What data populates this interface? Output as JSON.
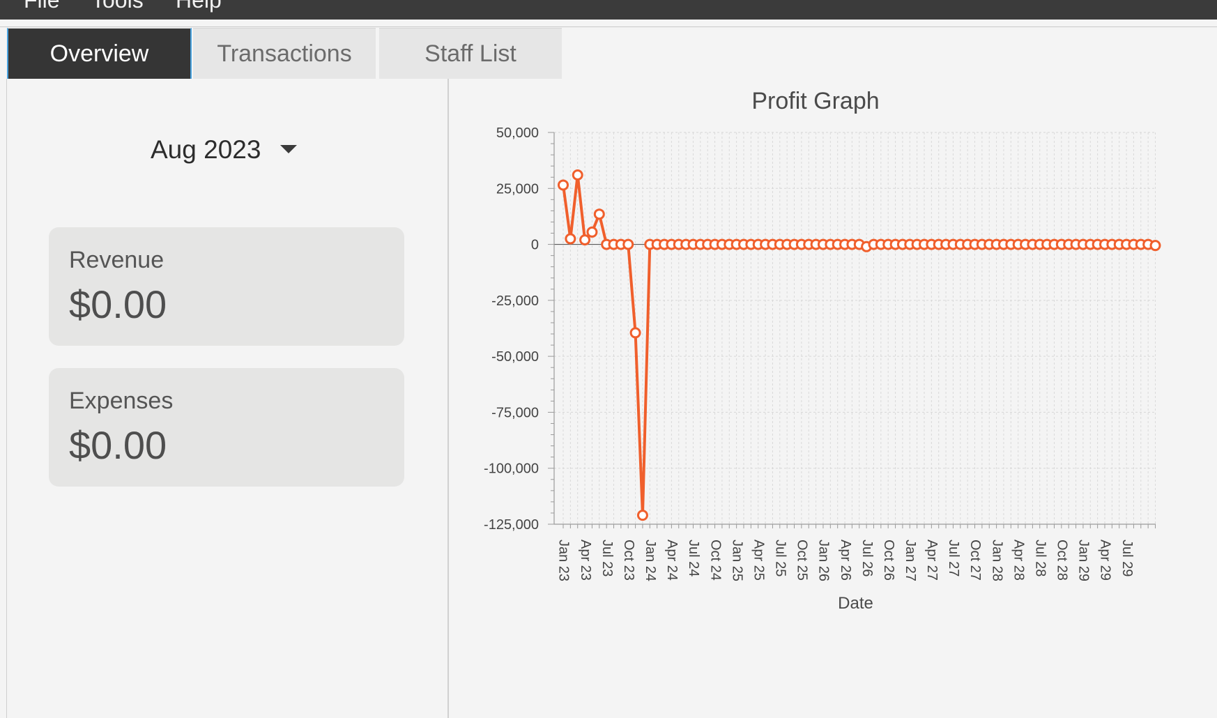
{
  "menu": {
    "items": [
      "File",
      "Tools",
      "Help"
    ]
  },
  "tabs": [
    {
      "label": "Overview",
      "active": true
    },
    {
      "label": "Transactions",
      "active": false
    },
    {
      "label": "Staff List",
      "active": false
    }
  ],
  "overview": {
    "month_selector": {
      "value": "Aug 2023",
      "icon": "chevron-down-icon"
    },
    "cards": [
      {
        "label": "Revenue",
        "value": "$0.00"
      },
      {
        "label": "Expenses",
        "value": "$0.00"
      }
    ]
  },
  "colors": {
    "accent": "#f05f2c",
    "dark": "#353535",
    "card": "#e5e5e4",
    "tab_border": "#4aa3df"
  },
  "chart_data": {
    "type": "line",
    "title": "Profit Graph",
    "xlabel": "Date",
    "ylabel": "",
    "ylim": [
      -125000,
      50000
    ],
    "y_ticks": [
      "50,000",
      "25,000",
      "0",
      "-25,000",
      "-50,000",
      "-75,000",
      "-100,000",
      "-125,000"
    ],
    "y_tick_values": [
      50000,
      25000,
      0,
      -25000,
      -50000,
      -75000,
      -100000,
      -125000
    ],
    "grid": true,
    "x_tick_labels": [
      "Jan 23",
      "Apr 23",
      "Jul 23",
      "Oct 23",
      "Jan 24",
      "Apr 24",
      "Jul 24",
      "Oct 24",
      "Jan 25",
      "Apr 25",
      "Jul 25",
      "Oct 25",
      "Jan 26",
      "Apr 26",
      "Jul 26",
      "Oct 26",
      "Jan 27",
      "Apr 27",
      "Jul 27",
      "Oct 27",
      "Jan 28",
      "Apr 28",
      "Jul 28",
      "Oct 28",
      "Jan 29",
      "Apr 29",
      "Jul 29"
    ],
    "x_categories": [
      "Jan 23",
      "Feb 23",
      "Mar 23",
      "Apr 23",
      "May 23",
      "Jun 23",
      "Jul 23",
      "Aug 23",
      "Sep 23",
      "Oct 23",
      "Nov 23",
      "Dec 23",
      "Jan 24",
      "Feb 24",
      "Mar 24",
      "Apr 24",
      "May 24",
      "Jun 24",
      "Jul 24",
      "Aug 24",
      "Sep 24",
      "Oct 24",
      "Nov 24",
      "Dec 24",
      "Jan 25",
      "Feb 25",
      "Mar 25",
      "Apr 25",
      "May 25",
      "Jun 25",
      "Jul 25",
      "Aug 25",
      "Sep 25",
      "Oct 25",
      "Nov 25",
      "Dec 25",
      "Jan 26",
      "Feb 26",
      "Mar 26",
      "Apr 26",
      "May 26",
      "Jun 26",
      "Jul 26",
      "Aug 26",
      "Sep 26",
      "Oct 26",
      "Nov 26",
      "Dec 26",
      "Jan 27",
      "Feb 27",
      "Mar 27",
      "Apr 27",
      "May 27",
      "Jun 27",
      "Jul 27",
      "Aug 27",
      "Sep 27",
      "Oct 27",
      "Nov 27",
      "Dec 27",
      "Jan 28",
      "Feb 28",
      "Mar 28",
      "Apr 28",
      "May 28",
      "Jun 28",
      "Jul 28",
      "Aug 28",
      "Sep 28",
      "Oct 28",
      "Nov 28",
      "Dec 28",
      "Jan 29",
      "Feb 29",
      "Mar 29",
      "Apr 29",
      "May 29",
      "Jun 29",
      "Jul 29",
      "Aug 29",
      "Sep 29",
      "Oct 29",
      "Nov 29"
    ],
    "series": [
      {
        "values": [
          26500,
          2500,
          31000,
          2000,
          5500,
          13500,
          0,
          0,
          0,
          0,
          -39500,
          -121000,
          0,
          0,
          0,
          0,
          0,
          0,
          0,
          0,
          0,
          0,
          0,
          0,
          0,
          0,
          0,
          0,
          0,
          0,
          0,
          0,
          0,
          0,
          0,
          0,
          0,
          0,
          0,
          0,
          0,
          0,
          -1000,
          0,
          0,
          0,
          0,
          0,
          0,
          0,
          0,
          0,
          0,
          0,
          0,
          0,
          0,
          0,
          0,
          0,
          0,
          0,
          0,
          0,
          0,
          0,
          0,
          0,
          0,
          0,
          0,
          0,
          0,
          0,
          0,
          0,
          0,
          0,
          0,
          0,
          0,
          0,
          -500
        ]
      }
    ]
  }
}
